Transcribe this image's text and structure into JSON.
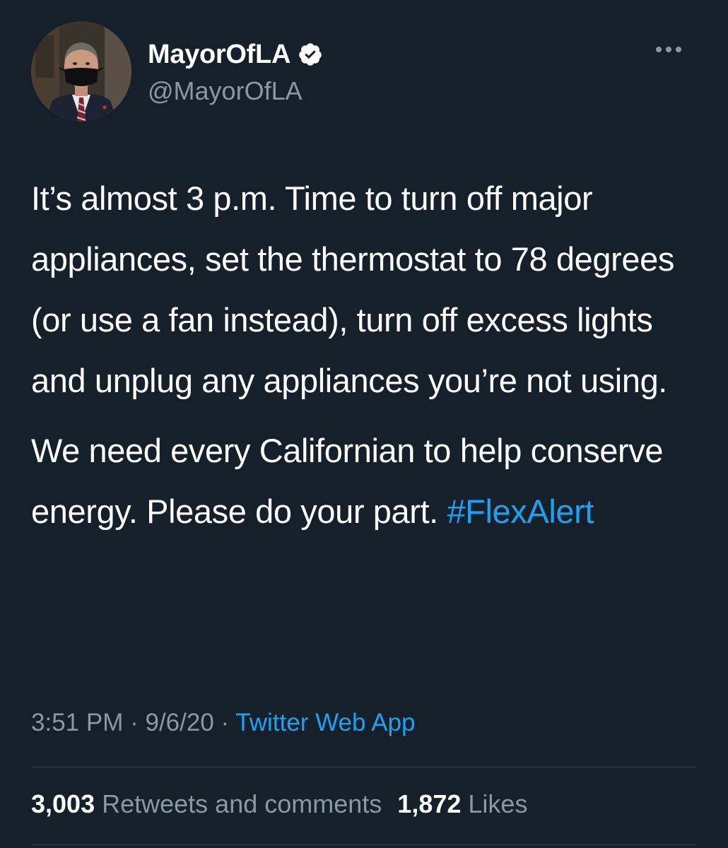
{
  "colors": {
    "background": "#15202b",
    "text": "#ffffff",
    "secondary_text": "#8899a6",
    "link": "#1da1f2",
    "divider": "#38444d",
    "verified_badge": "#ffffff"
  },
  "author": {
    "display_name": "MayorOfLA",
    "handle": "@MayorOfLA",
    "verified": true,
    "verified_icon": "verified-badge-icon",
    "avatar_icon": "avatar-photo"
  },
  "more_icon": "more-options-icon",
  "tweet": {
    "paragraph_1": "It’s almost 3 p.m. Time to turn off major appliances, set the thermostat to 78 degrees (or use a fan instead), turn off excess lights and unplug any appliances you’re not using.",
    "paragraph_2_text": "We need every Californian to help conserve energy. Please do your part. ",
    "hashtag": "#FlexAlert"
  },
  "meta": {
    "time": "3:51 PM",
    "separator": "·",
    "date": "9/6/20",
    "source": "Twitter Web App"
  },
  "stats": {
    "retweets_count": "3,003",
    "retweets_label": "Retweets and comments",
    "likes_count": "1,872",
    "likes_label": "Likes"
  }
}
